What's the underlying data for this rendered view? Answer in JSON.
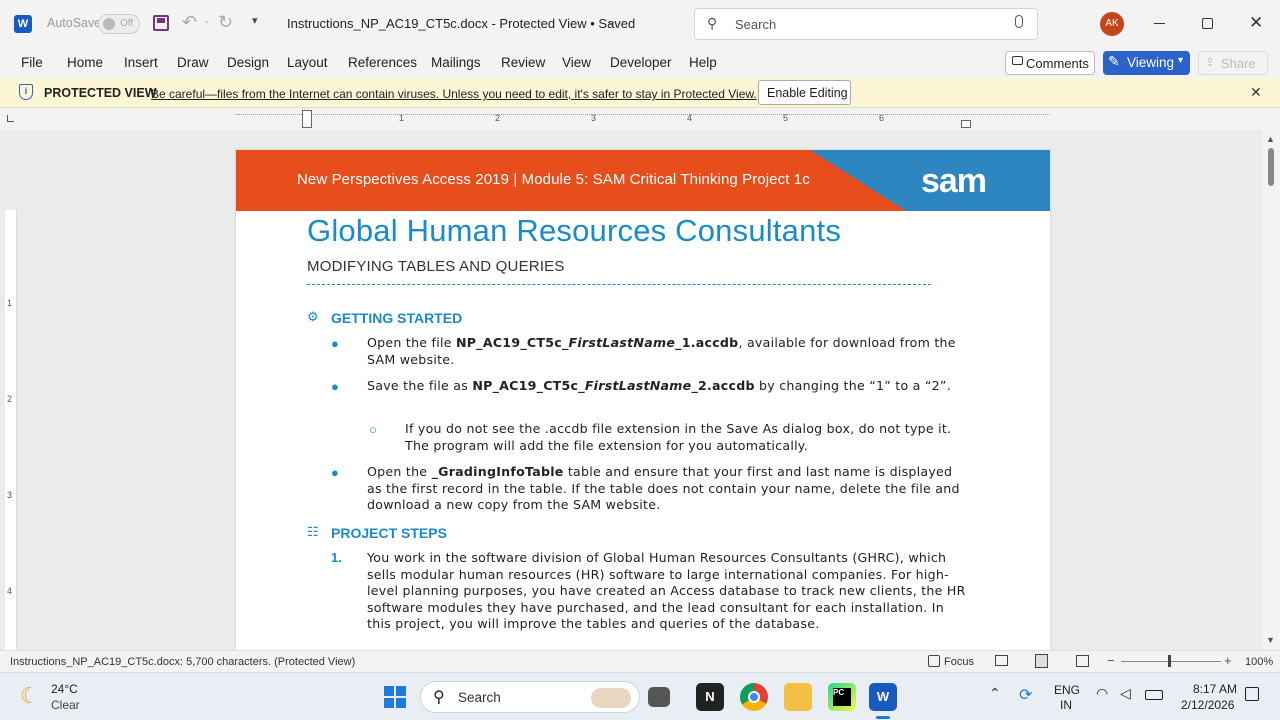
{
  "window": {
    "autosave_label": "AutoSave",
    "autosave_state": "Off",
    "doc_title": "Instructions_NP_AC19_CT5c.docx  -  Protected View • Saved",
    "search_placeholder": "Search",
    "user_initials": "AK"
  },
  "ribbon": {
    "tabs": [
      "File",
      "Home",
      "Insert",
      "Draw",
      "Design",
      "Layout",
      "References",
      "Mailings",
      "Review",
      "View",
      "Developer",
      "Help"
    ],
    "comments_label": "Comments",
    "viewing_label": "Viewing",
    "share_label": "Share"
  },
  "protected": {
    "title": "PROTECTED VIEW",
    "message": "Be careful—files from the Internet can contain viruses. Unless you need to edit, it's safer to stay in Protected View.",
    "enable_label": "Enable Editing"
  },
  "ruler": {
    "h_numbers": [
      "1",
      "2",
      "3",
      "4",
      "5",
      "6"
    ],
    "v_numbers": [
      "1",
      "2",
      "3",
      "4"
    ]
  },
  "document": {
    "banner": "New Perspectives Access 2019  |  Module 5: SAM Critical Thinking Project 1c",
    "logo": "sam",
    "title": "Global Human Resources Consultants",
    "subtitle": "MODIFYING TABLES AND QUERIES",
    "section1": "GETTING STARTED",
    "b1_pre": "Open the file ",
    "b1_bold1": "NP_AC19_CT5c",
    "b1_ital": "_FirstLastName",
    "b1_bold2": "_1.accdb",
    "b1_post": ", available for download from the SAM website.",
    "b2_pre": "Save the file as ",
    "b2_bold1": "NP_AC19_CT5c",
    "b2_ital": "_FirstLastName",
    "b2_bold2": "_2.accdb",
    "b2_post": " by changing the “1” to a “2”.",
    "b2_sub": "If you do not see the .accdb file extension in the Save As dialog box, do not type it. The program will add the file extension for you automatically.",
    "b3_pre": "Open the ",
    "b3_bold": "_GradingInfoTable",
    "b3_post": " table and ensure that your first and last name is displayed as the first record in the table. If the table does not contain your name, delete the file and download a new copy from the SAM website.",
    "section2": "PROJECT STEPS",
    "step1_num": "1.",
    "step1": "You work in the software division of Global Human Resources Consultants (GHRC), which sells modular human resources (HR) software to large international companies. For high-level planning purposes, you have created an Access database to track new clients, the HR software modules they have purchased, and the lead consultant for each installation. In this project, you will improve the tables and queries of the database."
  },
  "status": {
    "info": "Instructions_NP_AC19_CT5c.docx: 5,700 characters.  (Protected View)",
    "focus_label": "Focus",
    "zoom": "100%"
  },
  "taskbar": {
    "weather_temp": "24°C",
    "weather_desc": "Clear",
    "search_label": "Search",
    "lang_top": "ENG",
    "lang_bottom": "IN",
    "time": "8:17 AM",
    "date": "2/12/2026"
  }
}
